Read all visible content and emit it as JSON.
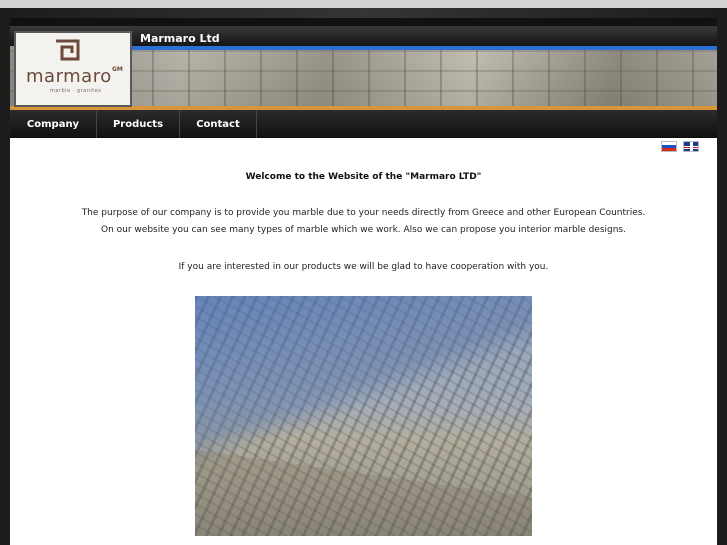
{
  "header": {
    "site_title": "Marmaro Ltd",
    "logo": {
      "word": "marmaro",
      "mark": "GM",
      "subtitle": "marble · granites"
    }
  },
  "nav": {
    "items": [
      {
        "label": "Company"
      },
      {
        "label": "Products"
      },
      {
        "label": "Contact"
      }
    ]
  },
  "languages": [
    {
      "icon": "russia-flag-icon"
    },
    {
      "icon": "uk-flag-icon"
    }
  ],
  "content": {
    "welcome": "Welcome to the Website of the \"Marmaro LTD\"",
    "paragraph1_line1": "The purpose of our company is to provide you marble due to your needs directly from Greece and other European Countries.",
    "paragraph1_line2": "On our website you can see many types of marble which we work. Also we can propose you interior marble designs.",
    "paragraph2": "If you are interested in our products we will be glad to have cooperation with you."
  },
  "colors": {
    "accent_blue": "#2e6fd6",
    "accent_orange": "#d9953a",
    "logo_brown": "#6b4a3b"
  }
}
